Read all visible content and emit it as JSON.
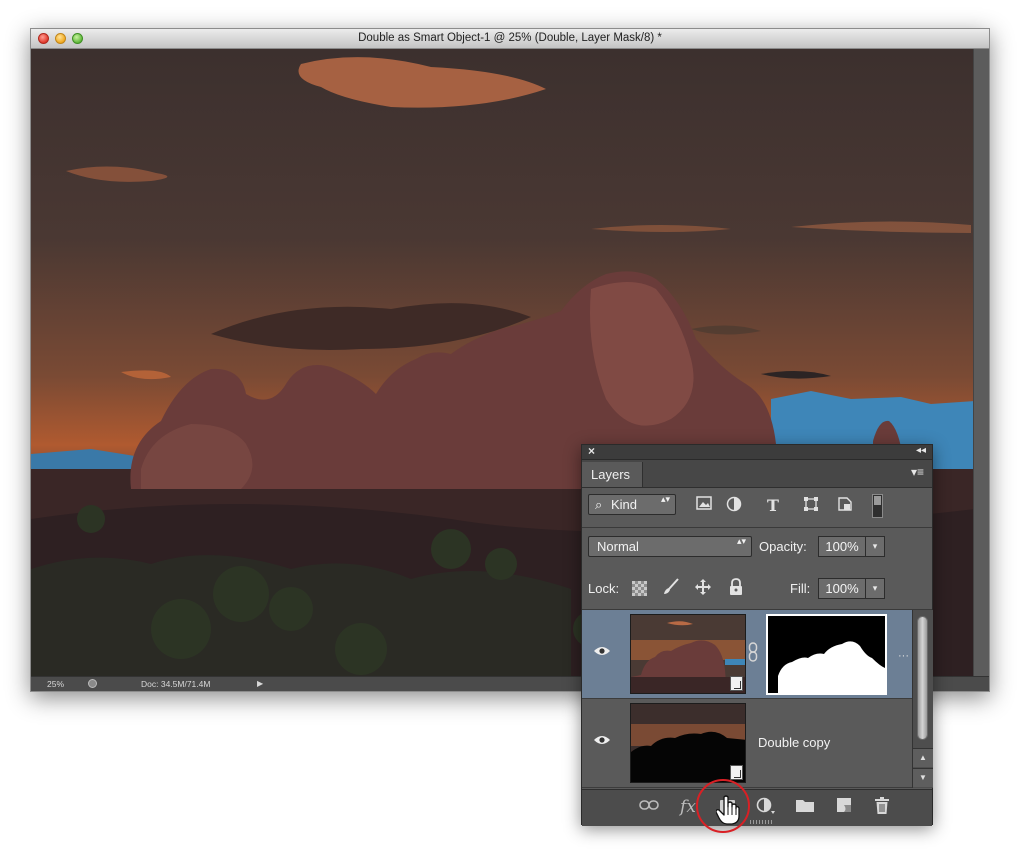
{
  "document": {
    "title": "Double as Smart Object-1 @ 25% (Double, Layer Mask/8) *",
    "status": {
      "zoom": "25%",
      "doc_size": "Doc: 34.5M/71.4M",
      "menu_arrow": "▶"
    }
  },
  "layers_panel": {
    "close_glyph": "×",
    "collapse_glyph": "◂◂",
    "menu_glyph": "▾≡",
    "tab_label": "Layers",
    "filter": {
      "kind_label": "Kind",
      "search_glyph": "⌕",
      "icons": [
        "image-filter-icon",
        "adjustment-filter-icon",
        "type-filter-icon",
        "shape-filter-icon",
        "smart-object-filter-icon"
      ],
      "type_glyph": "T"
    },
    "blend_mode": "Normal",
    "opacity_label": "Opacity:",
    "opacity_value": "100%",
    "lock_label": "Lock:",
    "fill_label": "Fill:",
    "fill_value": "100%",
    "layers": [
      {
        "name": "",
        "selected": true,
        "has_mask": true,
        "visible": true
      },
      {
        "name": "Double copy",
        "selected": false,
        "has_mask": false,
        "visible": true
      }
    ],
    "bottom_icons": [
      "link-layers-icon",
      "fx-icon",
      "add-layer-mask-icon",
      "adjustment-layer-icon",
      "new-group-icon",
      "new-layer-icon",
      "trash-icon"
    ],
    "fx_label": "fx",
    "eye_glyph": "👁",
    "arrow_up": "▲",
    "arrow_down": "▼",
    "dropdown_arrow": "▾",
    "updown_arrows": "▴▾"
  },
  "colors": {
    "selection": "#6c7f95",
    "highlight_circle": "#d92025",
    "panel_bg": "#5a5a5a"
  }
}
